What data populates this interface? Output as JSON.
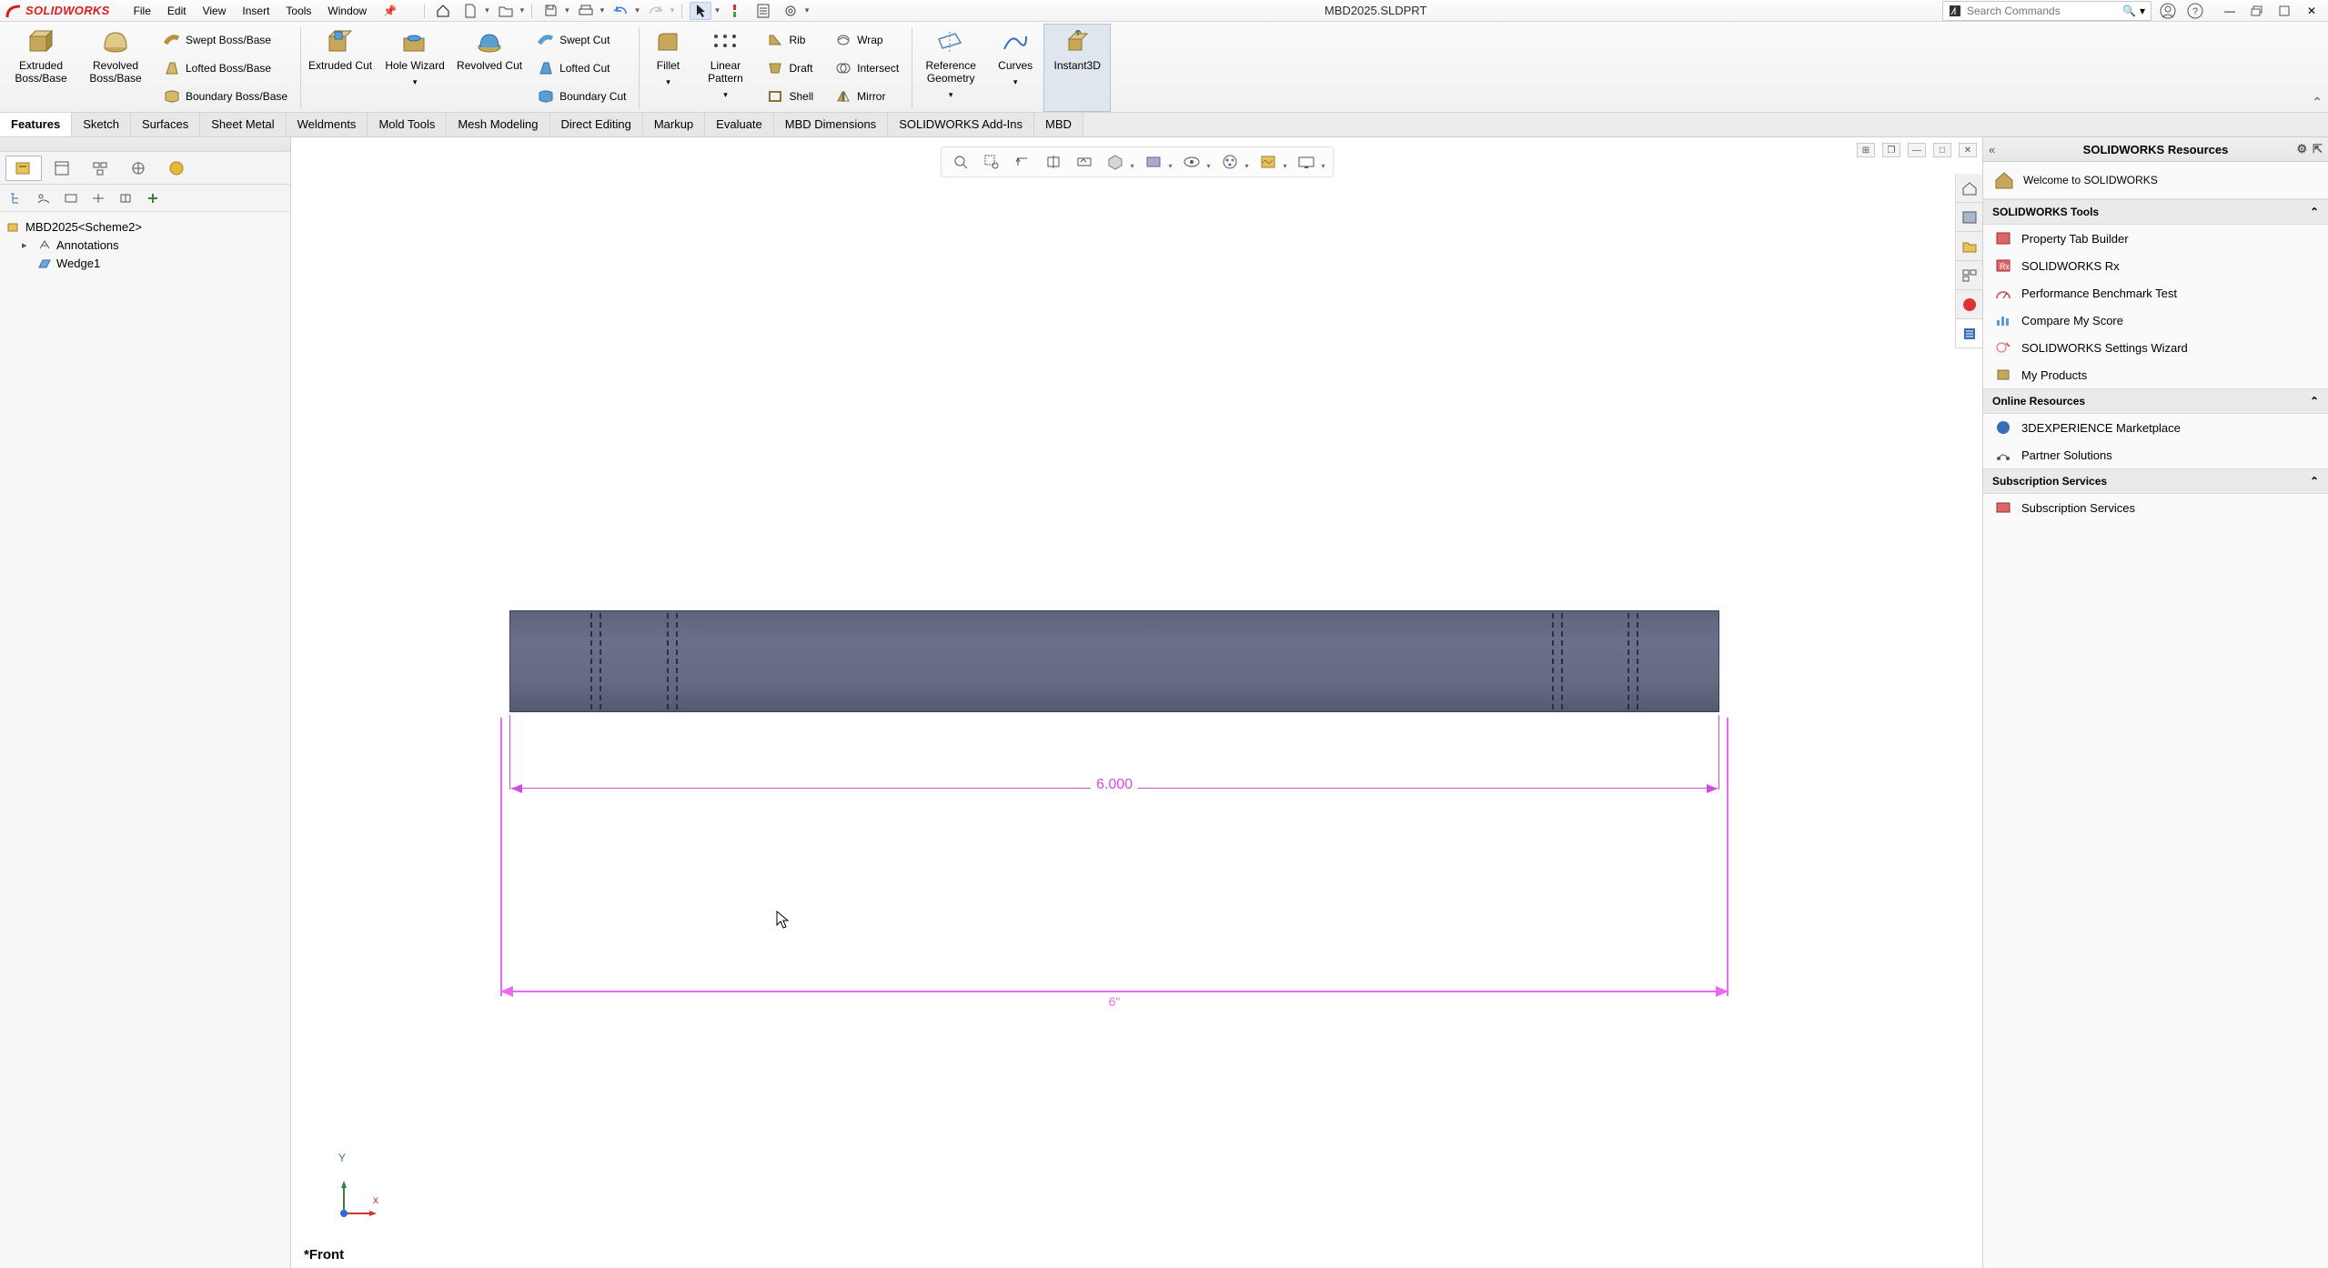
{
  "app": {
    "logo_text": "SOLIDWORKS",
    "document_title": "MBD2025.SLDPRT"
  },
  "menu": {
    "file": "File",
    "edit": "Edit",
    "view": "View",
    "insert": "Insert",
    "tools": "Tools",
    "window": "Window"
  },
  "search": {
    "placeholder": "Search Commands"
  },
  "ribbon": {
    "extruded_boss": "Extruded Boss/Base",
    "revolved_boss": "Revolved Boss/Base",
    "swept_boss": "Swept Boss/Base",
    "lofted_boss": "Lofted Boss/Base",
    "boundary_boss": "Boundary Boss/Base",
    "extruded_cut": "Extruded Cut",
    "hole_wizard": "Hole Wizard",
    "revolved_cut": "Revolved Cut",
    "swept_cut": "Swept Cut",
    "lofted_cut": "Lofted Cut",
    "boundary_cut": "Boundary Cut",
    "fillet": "Fillet",
    "linear_pattern": "Linear Pattern",
    "rib": "Rib",
    "draft": "Draft",
    "shell": "Shell",
    "wrap": "Wrap",
    "intersect": "Intersect",
    "mirror": "Mirror",
    "ref_geometry": "Reference Geometry",
    "curves": "Curves",
    "instant3d": "Instant3D"
  },
  "tabs": {
    "features": "Features",
    "sketch": "Sketch",
    "surfaces": "Surfaces",
    "sheet_metal": "Sheet Metal",
    "weldments": "Weldments",
    "mold_tools": "Mold Tools",
    "mesh_modeling": "Mesh Modeling",
    "direct_editing": "Direct Editing",
    "markup": "Markup",
    "evaluate": "Evaluate",
    "mbd_dimensions": "MBD Dimensions",
    "addins": "SOLIDWORKS Add-Ins",
    "mbd": "MBD"
  },
  "tree": {
    "root": "MBD2025<Scheme2>",
    "annotations": "Annotations",
    "wedge": "Wedge1"
  },
  "view": {
    "name": "*Front",
    "triad_y": "Y",
    "triad_x": "x",
    "dim_value": "6.000",
    "dim_sel_value": "6\""
  },
  "taskpane": {
    "title": "SOLIDWORKS Resources",
    "welcome": "Welcome to SOLIDWORKS",
    "tools_h": "SOLIDWORKS Tools",
    "prop_tab": "Property Tab Builder",
    "rx": "SOLIDWORKS Rx",
    "bench": "Performance Benchmark Test",
    "compare": "Compare My Score",
    "settings_wiz": "SOLIDWORKS Settings Wizard",
    "my_products": "My Products",
    "online_h": "Online Resources",
    "marketplace": "3DEXPERIENCE Marketplace",
    "partner": "Partner Solutions",
    "subs_h": "Subscription Services",
    "subs": "Subscription Services"
  },
  "colors": {
    "accent": "#d91e1e",
    "dim": "#d44adf",
    "dim_sel": "#e86bf2"
  }
}
